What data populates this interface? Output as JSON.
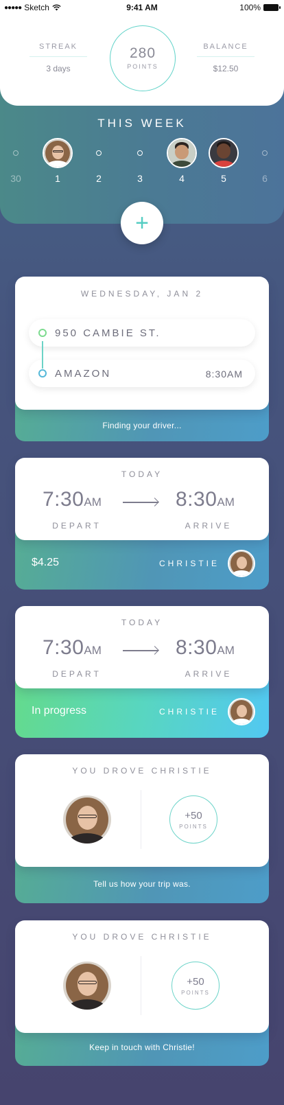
{
  "status_bar": {
    "carrier": "Sketch",
    "time": "9:41 AM",
    "battery": "100%"
  },
  "header": {
    "streak_label": "STREAK",
    "streak_value": "3 days",
    "points_value": "280",
    "points_label": "POINTS",
    "balance_label": "BALANCE",
    "balance_value": "$12.50"
  },
  "week": {
    "title": "THIS WEEK",
    "days": [
      {
        "num": "30",
        "marker": "dot",
        "faded": true
      },
      {
        "num": "1",
        "marker": "avatar",
        "avatar": "woman-glasses-avatar"
      },
      {
        "num": "2",
        "marker": "dot"
      },
      {
        "num": "3",
        "marker": "dot"
      },
      {
        "num": "4",
        "marker": "avatar",
        "avatar": "smiling-man-avatar"
      },
      {
        "num": "5",
        "marker": "avatar",
        "avatar": "man-red-shirt-avatar"
      },
      {
        "num": "6",
        "marker": "dot",
        "faded": true
      }
    ]
  },
  "add_button": {
    "icon": "plus-icon",
    "glyph": "+"
  },
  "booking": {
    "date": "WEDNESDAY, JAN 2",
    "origin": "950 CAMBIE ST.",
    "destination": "AMAZON",
    "destination_time": "8:30AM",
    "footer": "Finding your driver..."
  },
  "trip1": {
    "day": "TODAY",
    "depart_time": "7:30",
    "depart_ampm": "AM",
    "depart_label": "DEPART",
    "arrive_time": "8:30",
    "arrive_ampm": "AM",
    "arrive_label": "ARRIVE",
    "price": "$4.25",
    "driver": "CHRISTIE"
  },
  "trip2": {
    "day": "TODAY",
    "depart_time": "7:30",
    "depart_ampm": "AM",
    "depart_label": "DEPART",
    "arrive_time": "8:30",
    "arrive_ampm": "AM",
    "arrive_label": "ARRIVE",
    "status": "In progress",
    "driver": "CHRISTIE"
  },
  "review1": {
    "title": "YOU DROVE CHRISTIE",
    "bonus": "+50",
    "bonus_label": "POINTS",
    "footer": "Tell us how your trip was."
  },
  "review2": {
    "title": "YOU DROVE CHRISTIE",
    "bonus": "+50",
    "bonus_label": "POINTS",
    "footer": "Keep in touch with Christie!"
  },
  "colors": {
    "accent_teal": "#55cdc2",
    "origin_dot": "#7ddb8f",
    "destination_dot": "#55b8d8",
    "background_top": "#45668a",
    "background_bottom": "#46446e"
  }
}
